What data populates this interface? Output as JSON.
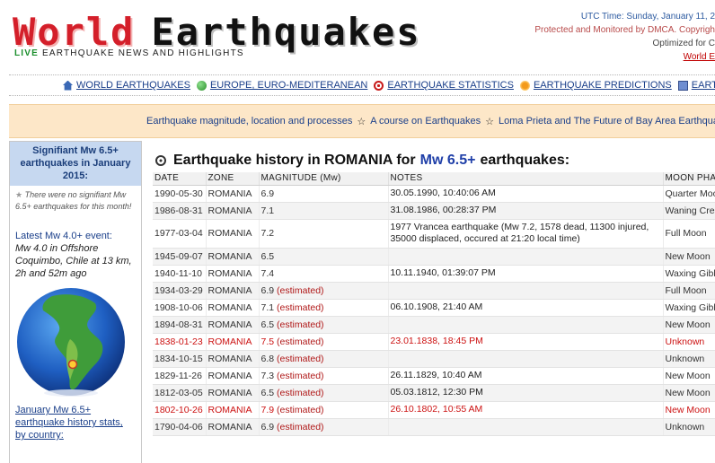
{
  "header": {
    "logo_part1": "World",
    "logo_part2": "Earthquakes",
    "tagline_live": "LIVE",
    "tagline_rest": " EARTHQUAKE NEWS AND HIGHLIGHTS",
    "utc": "UTC Time: Sunday, January 11, 2",
    "protected": "Protected and Monitored by DMCA. Copyrigh",
    "optimized": "Optimized for C",
    "link": "World E"
  },
  "nav": [
    {
      "label": "WORLD EARTHQUAKES",
      "icon": "home-icon"
    },
    {
      "label": "EUROPE, EURO-MEDITERANEAN",
      "icon": "globe-icon"
    },
    {
      "label": "EARTHQUAKE STATISTICS",
      "icon": "target-icon"
    },
    {
      "label": "EARTHQUAKE PREDICTIONS",
      "icon": "star-icon"
    },
    {
      "label": "EARTHQUAKE LIBR",
      "icon": "book-icon"
    }
  ],
  "infobar": {
    "link1": "Earthquake magnitude, location and processes",
    "link2": "A course on Earthquakes",
    "link3": "Loma Prieta and The Future of Bay Area Earthquak",
    "separator": "☆"
  },
  "sidebar": {
    "heading": "Signifiant Mw 6.5+ earthquakes in January 2015:",
    "none_star": "★",
    "none_text": "There were no signifiant Mw 6.5+ earthquakes for this month!",
    "latest_label": "Latest Mw 4.0+ event:",
    "latest_event": "Mw 4.0 in Offshore Coquimbo, Chile at 13 km, 2h and 52m ago",
    "stats_link": "January Mw 6.5+ earthquake history stats, by country:"
  },
  "main": {
    "title_prefix": "Earthquake history in ROMANIA for",
    "title_accent": "Mw 6.5+",
    "title_suffix": "earthquakes:",
    "columns": [
      "DATE",
      "ZONE",
      "MAGNITUDE (Mw)",
      "NOTES",
      "MOON PHASE"
    ],
    "estimated_label": "(estimated)",
    "rows": [
      {
        "date": "1990-05-30",
        "zone": "ROMANIA",
        "mag": "6.9",
        "est": "",
        "notes": "30.05.1990, 10:40:06 AM",
        "moon": "Quarter Moon"
      },
      {
        "date": "1986-08-31",
        "zone": "ROMANIA",
        "mag": "7.1",
        "est": "",
        "notes": "31.08.1986, 00:28:37 PM",
        "moon": "Waning Crescent Moon"
      },
      {
        "date": "1977-03-04",
        "zone": "ROMANIA",
        "mag": "7.2",
        "est": "",
        "notes": "1977 Vrancea earthquake (Mw 7.2, 1578 dead, 11300 injured, 35000 displaced, occured at 21:20 local time)",
        "moon": "Full Moon"
      },
      {
        "date": "1945-09-07",
        "zone": "ROMANIA",
        "mag": "6.5",
        "est": "",
        "notes": "",
        "moon": "New Moon"
      },
      {
        "date": "1940-11-10",
        "zone": "ROMANIA",
        "mag": "7.4",
        "est": "",
        "notes": "10.11.1940, 01:39:07 PM",
        "moon": "Waxing Gibbous Moon"
      },
      {
        "date": "1934-03-29",
        "zone": "ROMANIA",
        "mag": "6.9",
        "est": "(estimated)",
        "notes": "",
        "moon": "Full Moon"
      },
      {
        "date": "1908-10-06",
        "zone": "ROMANIA",
        "mag": "7.1",
        "est": "(estimated)",
        "notes": "06.10.1908, 21:40 AM",
        "moon": "Waxing Gibbous Moon"
      },
      {
        "date": "1894-08-31",
        "zone": "ROMANIA",
        "mag": "6.5",
        "est": "(estimated)",
        "notes": "",
        "moon": "New Moon"
      },
      {
        "date": "1838-01-23",
        "zone": "ROMANIA",
        "mag": "7.5",
        "est": "(estimated)",
        "notes": "23.01.1838, 18:45 PM",
        "moon": "Unknown",
        "red": true
      },
      {
        "date": "1834-10-15",
        "zone": "ROMANIA",
        "mag": "6.8",
        "est": "(estimated)",
        "notes": "",
        "moon": "Unknown"
      },
      {
        "date": "1829-11-26",
        "zone": "ROMANIA",
        "mag": "7.3",
        "est": "(estimated)",
        "notes": "26.11.1829, 10:40 AM",
        "moon": "New Moon"
      },
      {
        "date": "1812-03-05",
        "zone": "ROMANIA",
        "mag": "6.5",
        "est": "(estimated)",
        "notes": "05.03.1812, 12:30 PM",
        "moon": "New Moon"
      },
      {
        "date": "1802-10-26",
        "zone": "ROMANIA",
        "mag": "7.9",
        "est": "(estimated)",
        "notes": "26.10.1802, 10:55 AM",
        "moon": "New Moon",
        "red": true
      },
      {
        "date": "1790-04-06",
        "zone": "ROMANIA",
        "mag": "6.9",
        "est": "(estimated)",
        "notes": "",
        "moon": "Unknown"
      }
    ]
  },
  "colors": {
    "logo_red": "#d41f2a",
    "link_blue": "#1a3f8a",
    "accent_blue": "#1f3fa8",
    "highlight_red": "#cc1111",
    "infobar_bg": "#fde7c8",
    "sidebar_head_bg": "#c6d8f0"
  }
}
